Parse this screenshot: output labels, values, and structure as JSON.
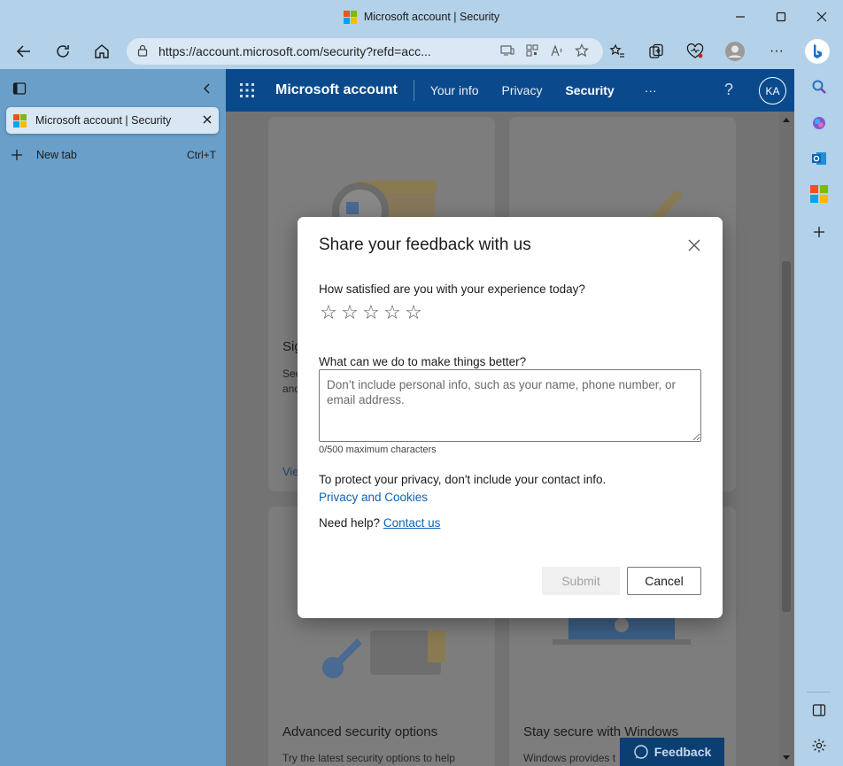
{
  "window": {
    "title": "Microsoft account | Security",
    "min_icon": "minimize-icon",
    "max_icon": "maximize-icon",
    "close_icon": "close-icon"
  },
  "address_bar": {
    "url": "https://account.microsoft.com/security?refd=acc..."
  },
  "sidebar": {
    "tab_title": "Microsoft account | Security",
    "new_tab_label": "New tab",
    "new_tab_shortcut": "Ctrl+T"
  },
  "ms_header": {
    "brand": "Microsoft account",
    "nav": [
      "Your info",
      "Privacy",
      "Security"
    ],
    "more": "···",
    "help": "?",
    "avatar_initials": "KA"
  },
  "background_cards": {
    "card1_title_fragment": "Sig",
    "card1_desc_fragment": [
      "See",
      "and"
    ],
    "card1_link_fragment": "Vie",
    "card3_title": "Advanced security options",
    "card3_desc": "Try the latest security options to help",
    "card4_title": "Stay secure with Windows",
    "card4_desc": "Windows provides t"
  },
  "feedback_button": "Feedback",
  "dialog": {
    "title": "Share your feedback with us",
    "question_rating": "How satisfied are you with your experience today?",
    "star_count": 5,
    "question_text": "What can we do to make things better?",
    "textarea_placeholder": "Don’t include personal info, such as your name, phone number, or email address.",
    "counter": "0/500 maximum characters",
    "privacy_note": "To protect your privacy, don't include your contact info.",
    "privacy_link": "Privacy and Cookies",
    "help_prefix": "Need help?",
    "help_link": "Contact us",
    "submit_label": "Submit",
    "cancel_label": "Cancel"
  },
  "colors": {
    "brand_header": "#0a4a8c",
    "link": "#0b62b8",
    "sidebar": "#699fc9",
    "chrome": "#b3d1e8"
  }
}
